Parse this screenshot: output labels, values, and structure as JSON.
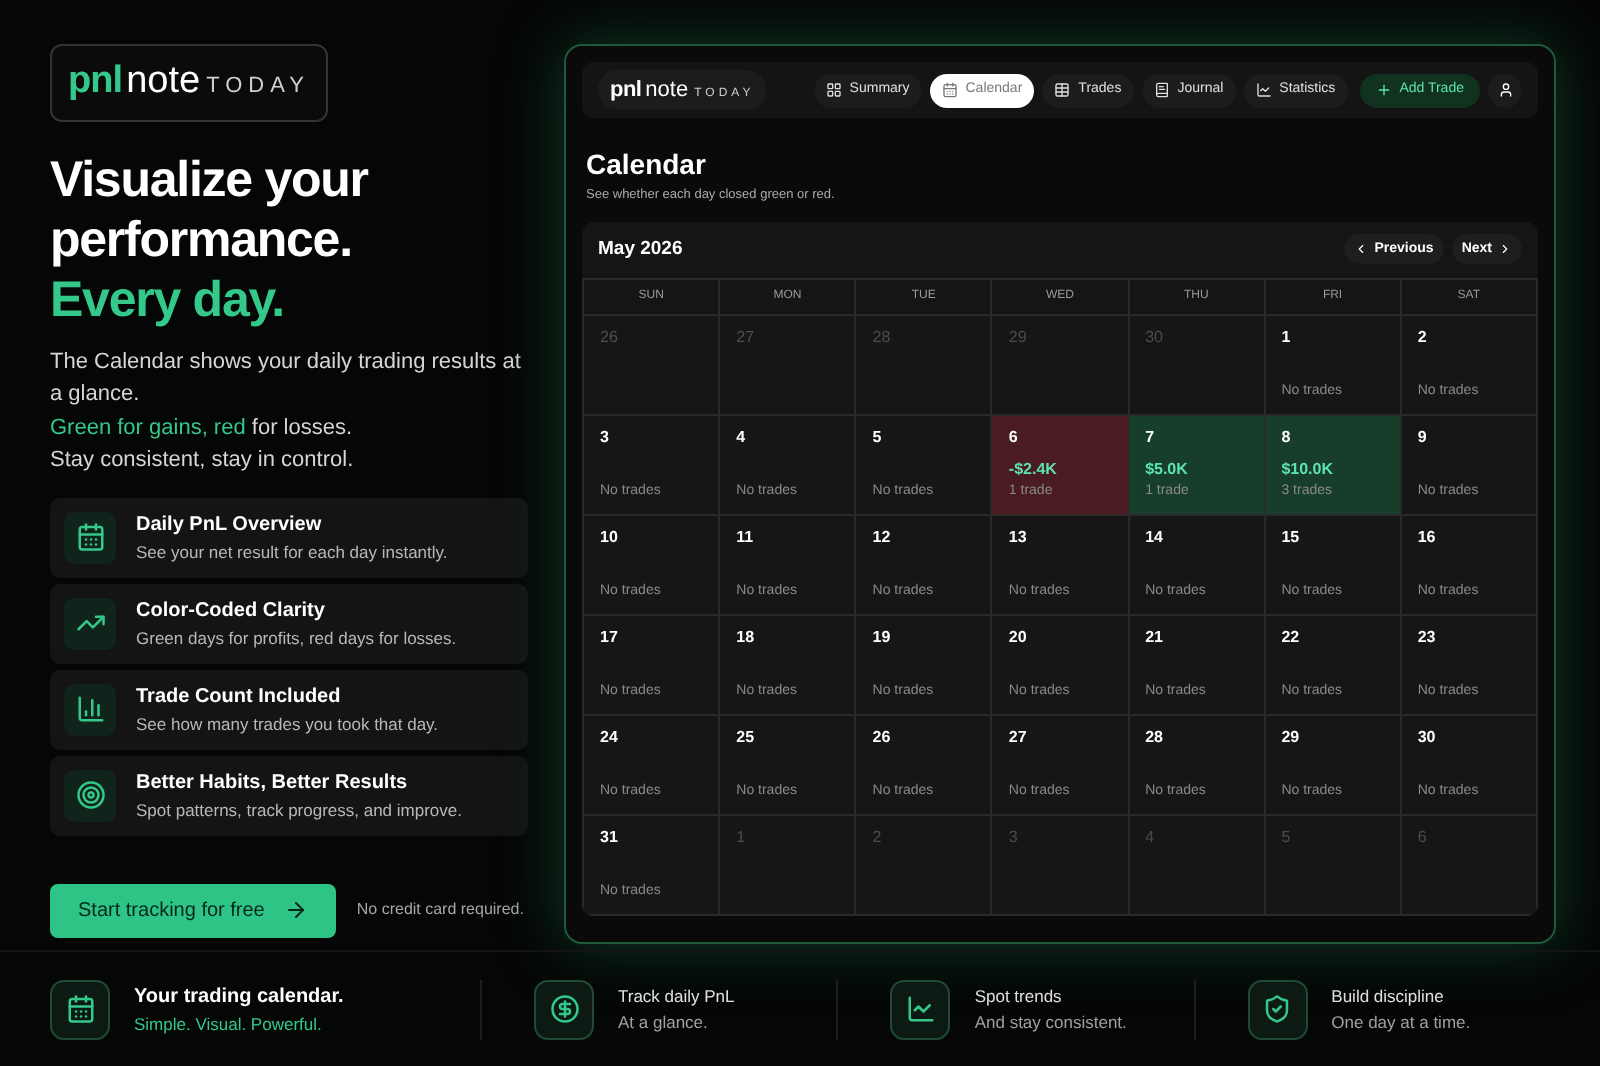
{
  "logo": {
    "mark": "pnl",
    "word": "note",
    "suffix": "TODAY"
  },
  "headline": {
    "lines": [
      "Visualize your",
      "performance."
    ],
    "accent": "Every day."
  },
  "intro": {
    "text": "The Calendar shows your daily trading results at a glance.",
    "parts": [
      {
        "text": "Green for gains, red",
        "accent": true
      },
      {
        "text": " for losses.",
        "accent": false
      }
    ],
    "closing": "Stay consistent, stay in control."
  },
  "features": [
    {
      "title": "Daily PnL Overview",
      "text": "See your net result for each day instantly."
    },
    {
      "title": "Color-Coded Clarity",
      "text": "Green days for profits, red days for losses."
    },
    {
      "title": "Trade Count Included",
      "text": "See how many trades you took that day."
    },
    {
      "title": "Better Habits, Better Results",
      "text": "Spot patterns, track progress, and improve."
    }
  ],
  "cta": {
    "button": "Start tracking for free",
    "note": "No credit card required."
  },
  "app": {
    "logo": {
      "mark": "pnl",
      "word": "note",
      "suffix": "TODAY"
    },
    "tabs": [
      {
        "label": "Summary",
        "selected": false
      },
      {
        "label": "Calendar",
        "selected": true
      },
      {
        "label": "Trades",
        "selected": false
      },
      {
        "label": "Journal",
        "selected": false
      },
      {
        "label": "Statistics",
        "selected": false
      }
    ],
    "add_button": "Add Trade",
    "title": "Calendar",
    "subtitle": "See whether each day closed green or red.",
    "calendar": {
      "month": "May 2026",
      "previous": "Previous",
      "next": "Next",
      "weekdays": [
        "SUN",
        "MON",
        "TUE",
        "WED",
        "THU",
        "FRI",
        "SAT"
      ],
      "weeks": [
        [
          {
            "day": "26",
            "kind": "outside"
          },
          {
            "day": "27",
            "kind": "outside"
          },
          {
            "day": "28",
            "kind": "outside"
          },
          {
            "day": "29",
            "kind": "outside"
          },
          {
            "day": "30",
            "kind": "outside"
          },
          {
            "day": "1",
            "kind": "empty",
            "trades": "No trades"
          },
          {
            "day": "2",
            "kind": "empty",
            "trades": "No trades"
          }
        ],
        [
          {
            "day": "3",
            "kind": "empty",
            "trades": "No trades"
          },
          {
            "day": "4",
            "kind": "empty",
            "trades": "No trades"
          },
          {
            "day": "5",
            "kind": "empty",
            "trades": "No trades"
          },
          {
            "day": "6",
            "kind": "loss",
            "pnl": "-$2.4K",
            "trades": "1 trade"
          },
          {
            "day": "7",
            "kind": "gain",
            "pnl": "$5.0K",
            "trades": "1 trade"
          },
          {
            "day": "8",
            "kind": "gain",
            "pnl": "$10.0K",
            "trades": "3 trades"
          },
          {
            "day": "9",
            "kind": "empty",
            "trades": "No trades"
          }
        ],
        [
          {
            "day": "10",
            "kind": "empty",
            "trades": "No trades"
          },
          {
            "day": "11",
            "kind": "empty",
            "trades": "No trades"
          },
          {
            "day": "12",
            "kind": "empty",
            "trades": "No trades"
          },
          {
            "day": "13",
            "kind": "empty",
            "trades": "No trades"
          },
          {
            "day": "14",
            "kind": "empty",
            "trades": "No trades"
          },
          {
            "day": "15",
            "kind": "empty",
            "trades": "No trades"
          },
          {
            "day": "16",
            "kind": "empty",
            "trades": "No trades"
          }
        ],
        [
          {
            "day": "17",
            "kind": "empty",
            "trades": "No trades"
          },
          {
            "day": "18",
            "kind": "empty",
            "trades": "No trades"
          },
          {
            "day": "19",
            "kind": "empty",
            "trades": "No trades"
          },
          {
            "day": "20",
            "kind": "empty",
            "trades": "No trades"
          },
          {
            "day": "21",
            "kind": "empty",
            "trades": "No trades"
          },
          {
            "day": "22",
            "kind": "empty",
            "trades": "No trades"
          },
          {
            "day": "23",
            "kind": "empty",
            "trades": "No trades"
          }
        ],
        [
          {
            "day": "24",
            "kind": "empty",
            "trades": "No trades"
          },
          {
            "day": "25",
            "kind": "empty",
            "trades": "No trades"
          },
          {
            "day": "26",
            "kind": "empty",
            "trades": "No trades"
          },
          {
            "day": "27",
            "kind": "empty",
            "trades": "No trades"
          },
          {
            "day": "28",
            "kind": "empty",
            "trades": "No trades"
          },
          {
            "day": "29",
            "kind": "empty",
            "trades": "No trades"
          },
          {
            "day": "30",
            "kind": "empty",
            "trades": "No trades"
          }
        ],
        [
          {
            "day": "31",
            "kind": "empty",
            "trades": "No trades"
          },
          {
            "day": "1",
            "kind": "outside"
          },
          {
            "day": "2",
            "kind": "outside"
          },
          {
            "day": "3",
            "kind": "outside"
          },
          {
            "day": "4",
            "kind": "outside"
          },
          {
            "day": "5",
            "kind": "outside"
          },
          {
            "day": "6",
            "kind": "outside"
          }
        ]
      ]
    }
  },
  "footer": [
    {
      "title": "Your trading calendar.",
      "text": "Simple. Visual. Powerful.",
      "accent": true
    },
    {
      "title": "Track daily PnL",
      "text": "At a glance.",
      "accent": false
    },
    {
      "title": "Spot trends",
      "text": "And stay consistent.",
      "accent": false
    },
    {
      "title": "Build discipline",
      "text": "One day at a time.",
      "accent": false
    }
  ]
}
